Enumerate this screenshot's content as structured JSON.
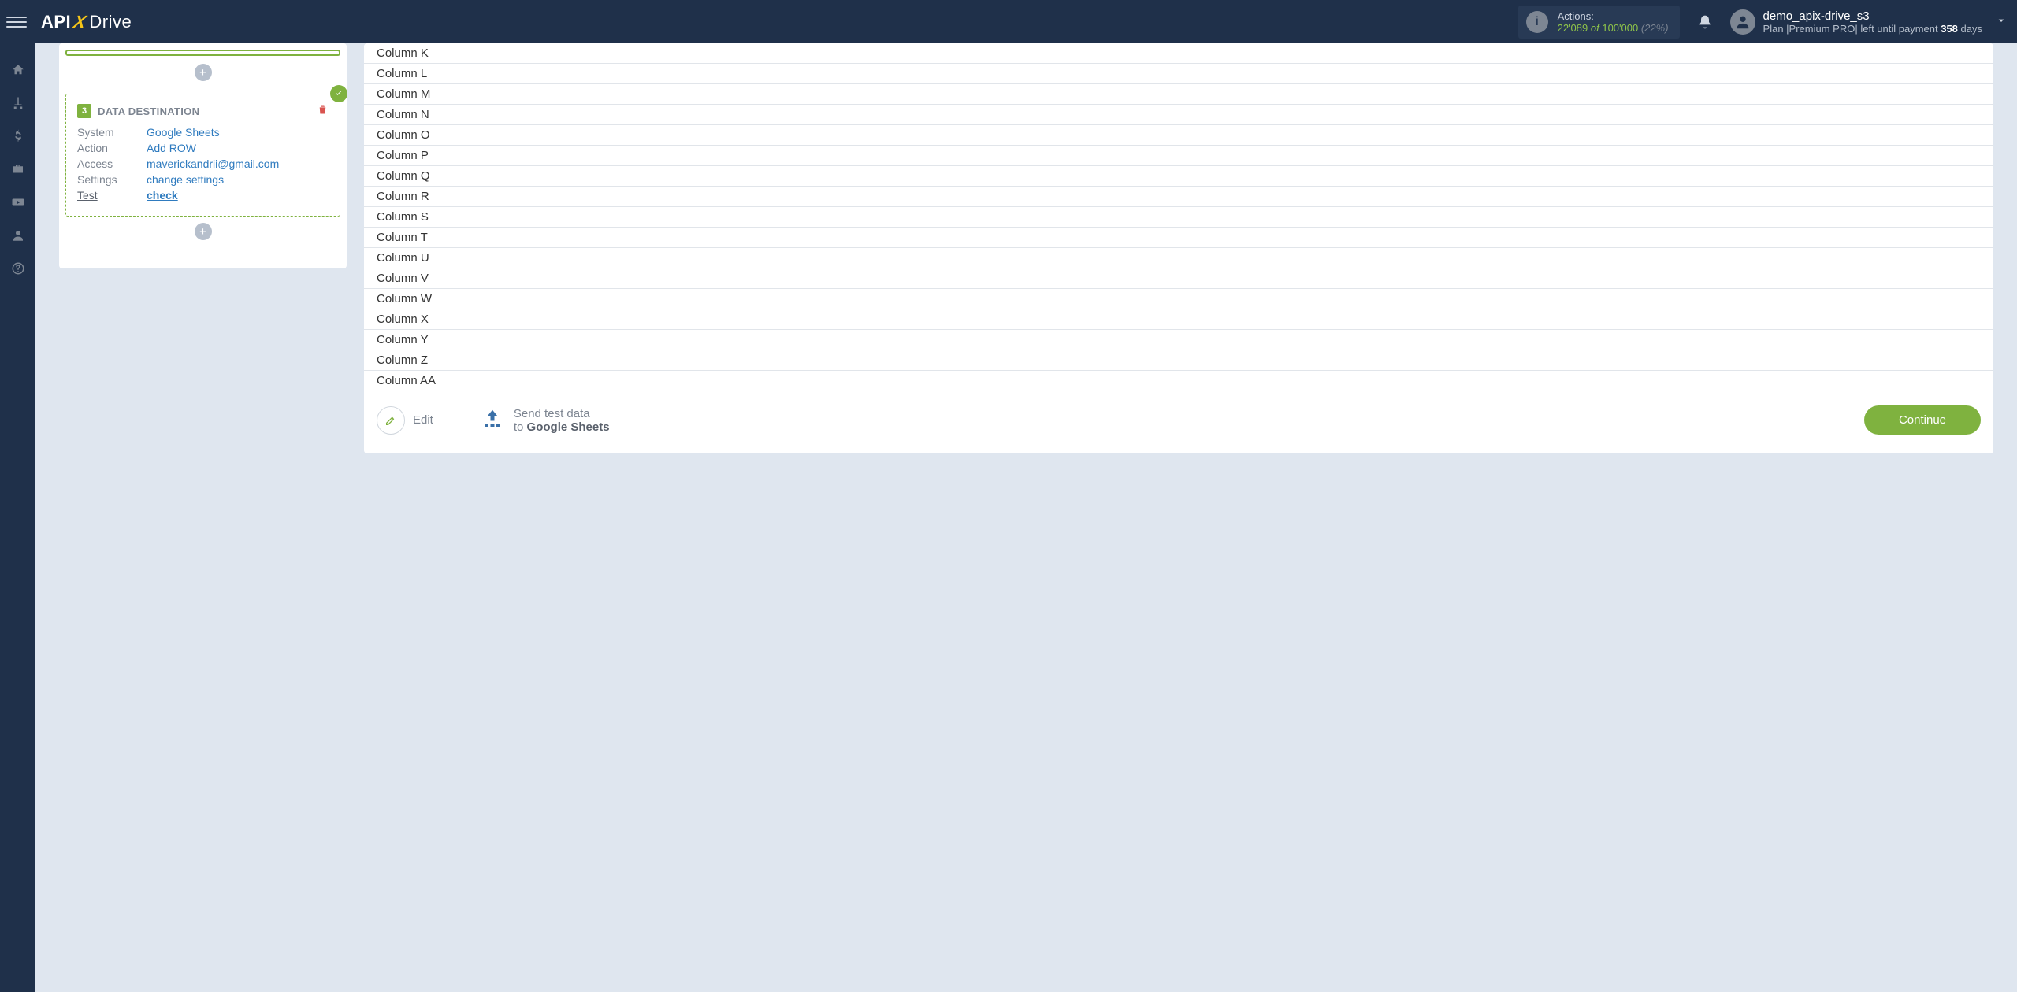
{
  "header": {
    "logo_api": "API",
    "logo_x": "X",
    "logo_drive": "Drive",
    "actions_label": "Actions:",
    "actions_used": "22'089",
    "actions_of": "of",
    "actions_total": "100'000",
    "actions_pct": "(22%)",
    "user_name": "demo_apix-drive_s3",
    "plan_prefix": "Plan |",
    "plan_name": "Premium PRO",
    "plan_mid": "| left until payment ",
    "plan_days": "358",
    "plan_suffix": " days"
  },
  "destination": {
    "step_num": "3",
    "title": "DATA DESTINATION",
    "rows": {
      "system_k": "System",
      "system_v": "Google Sheets",
      "action_k": "Action",
      "action_v": "Add ROW",
      "access_k": "Access",
      "access_v": "maverickandrii@gmail.com",
      "settings_k": "Settings",
      "settings_v": "change settings",
      "test_k": "Test",
      "test_v": "check"
    }
  },
  "columns": [
    "Column K",
    "Column L",
    "Column M",
    "Column N",
    "Column O",
    "Column P",
    "Column Q",
    "Column R",
    "Column S",
    "Column T",
    "Column U",
    "Column V",
    "Column W",
    "Column X",
    "Column Y",
    "Column Z",
    "Column AA"
  ],
  "footer": {
    "edit": "Edit",
    "send_l1": "Send test data",
    "send_l2_prefix": "to ",
    "send_l2_target": "Google Sheets",
    "continue": "Continue"
  }
}
